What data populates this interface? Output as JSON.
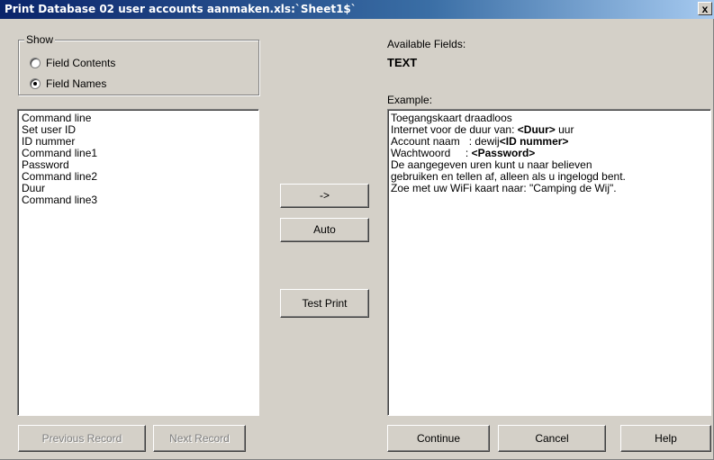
{
  "window": {
    "title": "Print Database 02 user accounts aanmaken.xls:`Sheet1$`",
    "close_label": "x"
  },
  "show_group": {
    "label": "Show",
    "options": [
      {
        "label": "Field Contents",
        "selected": false
      },
      {
        "label": "Field Names",
        "selected": true
      }
    ]
  },
  "fields_list": [
    "Command line",
    "Set user ID",
    "ID nummer",
    "Command line1",
    "Password",
    "Command line2",
    "Duur",
    "Command line3"
  ],
  "available_fields": {
    "label": "Available Fields:",
    "value": "TEXT"
  },
  "example": {
    "label": "Example:",
    "lines": [
      {
        "plain": "Toegangskaart draadloos",
        "bold": "",
        "after": ""
      },
      {
        "plain": "Internet voor de duur van: ",
        "bold": "<Duur>",
        "after": " uur"
      },
      {
        "plain": "Account naam   : dewij",
        "bold": "<ID nummer>",
        "after": ""
      },
      {
        "plain": "Wachtwoord     : ",
        "bold": "<Password>",
        "after": ""
      },
      {
        "plain": "De aangegeven uren kunt u naar believen",
        "bold": "",
        "after": ""
      },
      {
        "plain": "gebruiken en tellen af, alleen als u ingelogd bent.",
        "bold": "",
        "after": ""
      },
      {
        "plain": "Zoe met uw WiFi kaart naar: \"Camping de Wij\".",
        "bold": "",
        "after": ""
      }
    ]
  },
  "buttons": {
    "arrow": "->",
    "auto": "Auto",
    "test_print": "Test Print",
    "previous_record": "Previous Record",
    "next_record": "Next Record",
    "continue": "Continue",
    "cancel": "Cancel",
    "help": "Help"
  }
}
